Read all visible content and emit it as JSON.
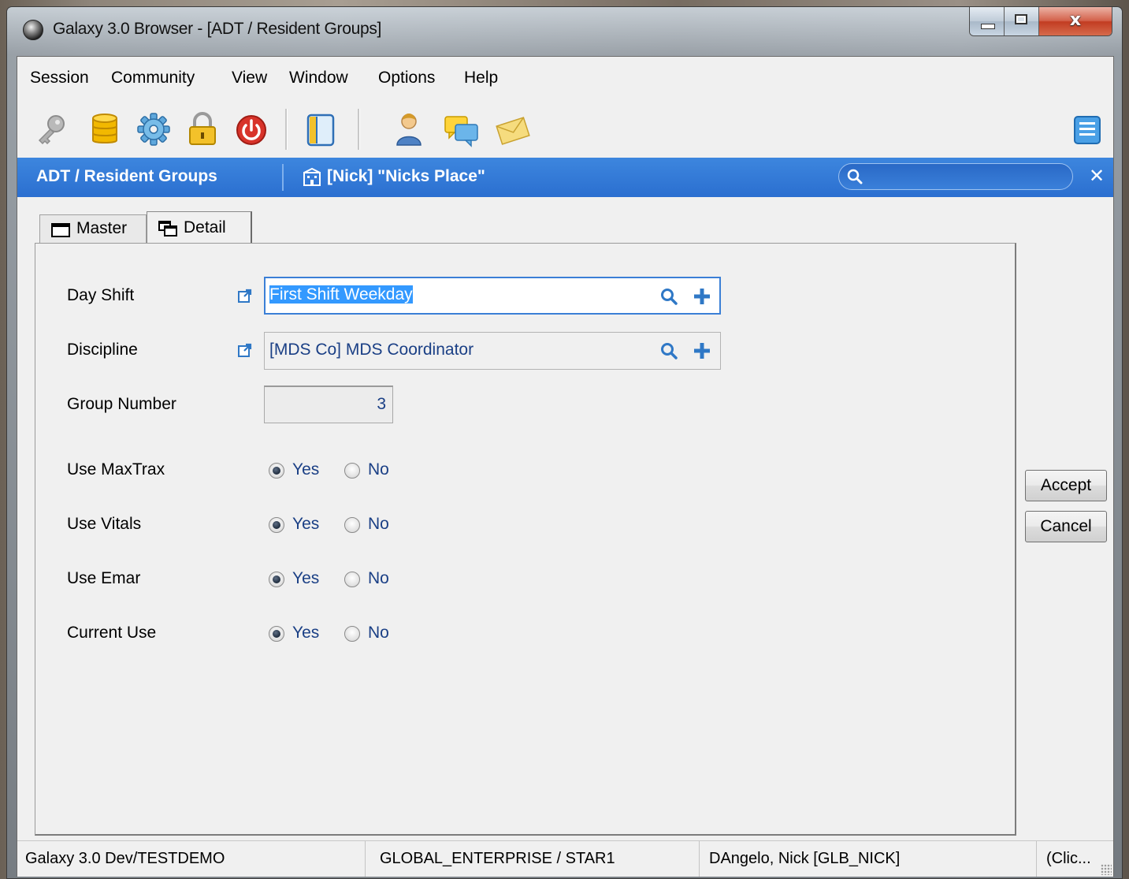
{
  "window": {
    "title": "Galaxy 3.0 Browser - [ADT / Resident Groups]",
    "close_glyph": "x"
  },
  "menu": [
    "Session",
    "Community",
    "View",
    "Window",
    "Options",
    "Help"
  ],
  "toolbar": {
    "icons": [
      "key-icon",
      "database-icon",
      "gear-icon",
      "lock-icon",
      "power-icon",
      "panel-icon",
      "user-icon",
      "chat-icon",
      "mail-icon",
      "list-menu-icon"
    ]
  },
  "header_bar": {
    "module": "ADT / Resident Groups",
    "facility": "[Nick] \"Nicks Place\"",
    "search_value": "",
    "close_glyph": "✕",
    "color": "#2f74d4"
  },
  "tabs": [
    {
      "label": "Master",
      "icon": "window-icon",
      "active": false
    },
    {
      "label": "Detail",
      "icon": "detail-windows-icon",
      "active": true
    }
  ],
  "form": {
    "day_shift": {
      "label": "Day Shift",
      "value": "First Shift Weekday"
    },
    "discipline": {
      "label": "Discipline",
      "value": "[MDS Co] MDS Coordinator"
    },
    "group_number": {
      "label": "Group Number",
      "value": "3"
    },
    "use_maxtrax": {
      "label": "Use MaxTrax",
      "yes": "Yes",
      "no": "No",
      "selected": "Yes"
    },
    "use_vitals": {
      "label": "Use Vitals",
      "yes": "Yes",
      "no": "No",
      "selected": "Yes"
    },
    "use_emar": {
      "label": "Use Emar",
      "yes": "Yes",
      "no": "No",
      "selected": "Yes"
    },
    "current_use": {
      "label": "Current Use",
      "yes": "Yes",
      "no": "No",
      "selected": "Yes"
    }
  },
  "actions": {
    "accept": "Accept",
    "cancel": "Cancel"
  },
  "status": {
    "environment": "Galaxy 3.0 Dev/TESTDEMO",
    "enterprise": "GLOBAL_ENTERPRISE / STAR1",
    "user": "DAngelo, Nick  [GLB_NICK]",
    "hint": "(Clic..."
  }
}
